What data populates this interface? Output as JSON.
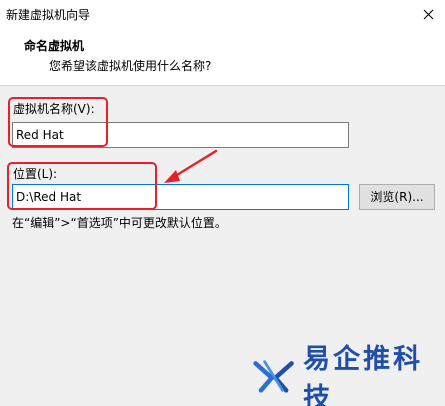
{
  "window": {
    "title": "新建虚拟机向导"
  },
  "header": {
    "title": "命名虚拟机",
    "subtitle": "您希望该虚拟机使用什么名称?"
  },
  "form": {
    "name_label": "虚拟机名称(V):",
    "name_value": "Red Hat",
    "location_label": "位置(L):",
    "location_value": "D:\\Red Hat",
    "browse_label": "浏览(R)...",
    "hint": "在“编辑”>“首选项”中可更改默认位置。"
  },
  "watermark": {
    "text": "易企推科技",
    "logo": "x-logo-icon"
  },
  "colors": {
    "highlight": "#e8202a",
    "watermark": "#1f4fa8",
    "focus": "#0078d7"
  }
}
